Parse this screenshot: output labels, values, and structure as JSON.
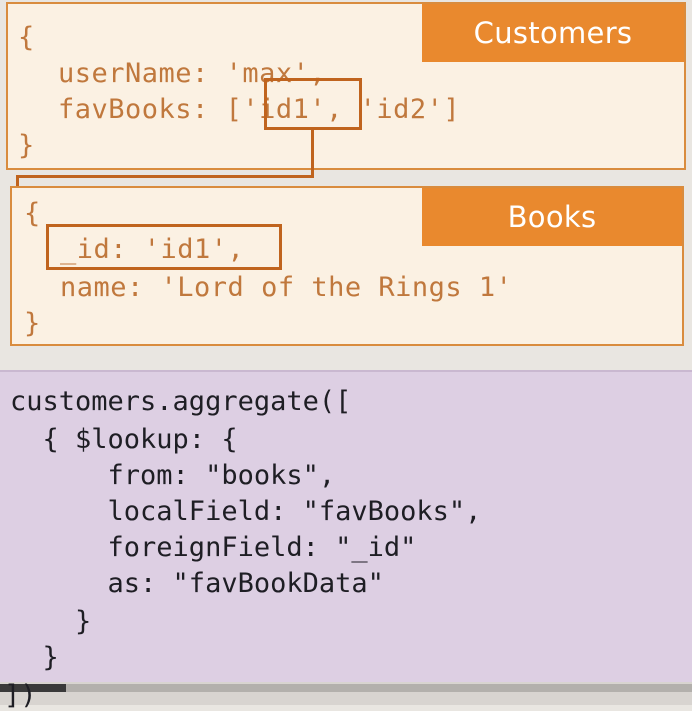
{
  "customers": {
    "tag": "Customers",
    "open_brace": "{",
    "line1_key": "userName:",
    "line1_val": "'max',",
    "line2_key": "favBooks:",
    "line2_bracket": "[",
    "line2_hl": "'id1'",
    "line2_rest": ", 'id2']",
    "close_brace": "}"
  },
  "books": {
    "tag": "Books",
    "open_brace": "{",
    "line1_hl": "_id: 'id1',",
    "line2": "name: 'Lord of the Rings 1'",
    "close_brace": "}"
  },
  "aggregate": {
    "lines": [
      "customers.aggregate([",
      "  { $lookup: {",
      "      from: \"books\",",
      "      localField: \"favBooks\",",
      "      foreignField: \"_id\"",
      "      as: \"favBookData\"",
      "    }",
      "  }",
      "])"
    ]
  },
  "colors": {
    "accent": "#e9892e",
    "panel_bg": "#fbf1e3",
    "code_text": "#c0783d",
    "aggregate_bg": "#ddcfe3"
  }
}
